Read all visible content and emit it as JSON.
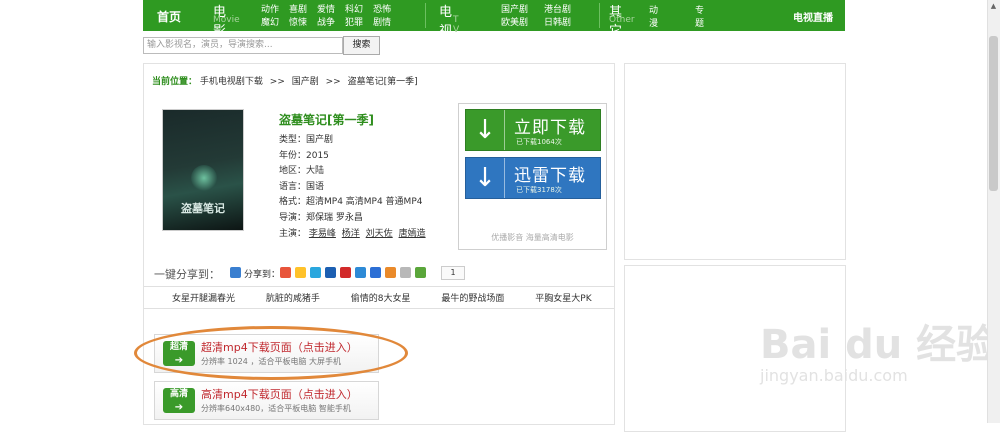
{
  "nav": {
    "home": "首页",
    "groups": [
      {
        "big": "电 影",
        "sub": "Movie",
        "items": [
          "动作",
          "魔幻",
          "喜剧",
          "惊悚",
          "爱情",
          "战争",
          "科幻",
          "犯罪",
          "恐怖",
          "剧情"
        ]
      },
      {
        "big": "电 视 剧",
        "sub": "T V",
        "items": [
          "国产剧",
          "欧美剧",
          "港台剧",
          "日韩剧"
        ]
      },
      {
        "big": "其 它",
        "sub": "Other",
        "items": [
          "动漫",
          "专题"
        ]
      }
    ],
    "tv_live": "电视直播"
  },
  "search": {
    "placeholder": "输入影视名，演员，导演搜索...",
    "button": "搜索"
  },
  "breadcrumb": {
    "label": "当前位置：",
    "items": [
      "手机电视剧下载",
      "国产剧",
      "盗墓笔记[第一季]"
    ],
    "sep": ">>"
  },
  "poster": {
    "title": "盗墓笔记"
  },
  "movie": {
    "title": "盗墓笔记[第一季]",
    "type": "类型：国产剧",
    "year": "年份：2015",
    "region": "地区：大陆",
    "language": "语言：国语",
    "format": "格式：超清MP4 高清MP4 普通MP4",
    "director": "导演：郑保瑞 罗永昌",
    "cast_label": "主演：",
    "cast": [
      "李易峰",
      "杨洋",
      "刘天佐",
      "唐嫣造"
    ]
  },
  "download": {
    "now": {
      "label": "立即下载",
      "count": "已下载1064次"
    },
    "xunlei": {
      "label": "迅雷下载",
      "count": "已下载3178次"
    },
    "slogan": "优播影音 海量高清电影"
  },
  "share": {
    "label": "一键分享到：",
    "to": "分享到：",
    "count": "1"
  },
  "tags": [
    "女星开腿漏春光",
    "肮脏的咸猪手",
    "偷情的8大女星",
    "最牛的野战场面",
    "平胸女星大PK"
  ],
  "cards": [
    {
      "badge": "超清",
      "title": "超清mp4下载页面（点击进入）",
      "desc": "分辨率 1024 ，适合平板电脑  大屏手机"
    },
    {
      "badge": "高清",
      "title": "高清mp4下载页面（点击进入）",
      "desc": "分辨率640x480，适合平板电脑  智能手机"
    }
  ],
  "watermark": {
    "brand": "Bai du 经验",
    "url": "jingyan.baidu.com"
  },
  "colors": {
    "nav": "#2f9a22",
    "green_btn": "#3a9a2a",
    "blue_btn": "#2f76c0",
    "highlight": "#e1883a",
    "card_title": "#c0282e"
  }
}
